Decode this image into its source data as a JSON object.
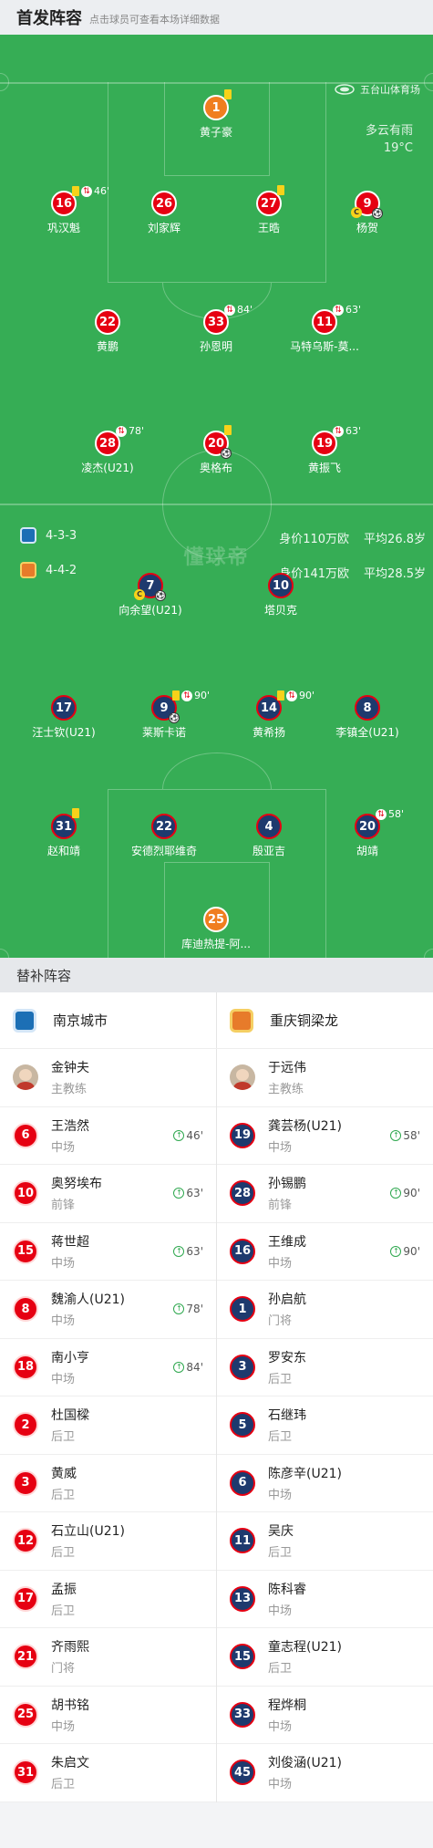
{
  "header": {
    "title": "首发阵容",
    "subtitle": "点击球员可查看本场详细数据"
  },
  "pitch": {
    "venue": "五台山体育场",
    "weather": "多云有雨",
    "temperature": "19°C",
    "watermark": "懂球帝",
    "home_formation": "4-3-3",
    "home_value": "身价110万欧",
    "home_avg_age": "平均26.8岁",
    "away_formation": "4-4-2",
    "away_value": "身价141万欧",
    "away_avg_age": "平均28.5岁",
    "home_players": [
      {
        "num": "1",
        "name": "黄子豪",
        "gk": true,
        "yellow": true
      },
      {
        "num": "16",
        "name": "巩汉魁",
        "yellow": true,
        "sub": "46'"
      },
      {
        "num": "26",
        "name": "刘家辉"
      },
      {
        "num": "27",
        "name": "王晧",
        "yellow": true
      },
      {
        "num": "9",
        "name": "杨贺",
        "captain": "C",
        "ball": true
      },
      {
        "num": "22",
        "name": "黄鹏"
      },
      {
        "num": "33",
        "name": "孙恩明",
        "sub": "84'"
      },
      {
        "num": "11",
        "name": "马特乌斯-莫...",
        "sub": "63'"
      },
      {
        "num": "28",
        "name": "凌杰(U21)",
        "sub": "78'"
      },
      {
        "num": "20",
        "name": "奥格布",
        "yellow": true,
        "ball": true
      },
      {
        "num": "19",
        "name": "黄振飞",
        "sub": "63'"
      }
    ],
    "away_players": [
      {
        "num": "7",
        "name": "向余望(U21)",
        "captain": "C",
        "ball": true
      },
      {
        "num": "10",
        "name": "塔贝克"
      },
      {
        "num": "17",
        "name": "汪士钦(U21)"
      },
      {
        "num": "9",
        "name": "莱斯卡诺",
        "yellow": true,
        "sub": "90'",
        "ball": true
      },
      {
        "num": "14",
        "name": "黄希扬",
        "yellow": true,
        "sub": "90'"
      },
      {
        "num": "8",
        "name": "李镇全(U21)"
      },
      {
        "num": "31",
        "name": "赵和靖",
        "yellow": true
      },
      {
        "num": "22",
        "name": "安德烈耶维奇"
      },
      {
        "num": "4",
        "name": "殷亚吉"
      },
      {
        "num": "20",
        "name": "胡靖",
        "sub": "58'"
      },
      {
        "num": "25",
        "name": "库迪热提-阿...",
        "gk": true
      }
    ]
  },
  "subs": {
    "title": "替补阵容",
    "home_team": "南京城市",
    "away_team": "重庆铜梁龙",
    "home": [
      {
        "coach": true,
        "name": "金钟夫",
        "pos": "主教练"
      },
      {
        "num": "6",
        "name": "王浩然",
        "pos": "中场",
        "min": "46'"
      },
      {
        "num": "10",
        "name": "奥努埃布",
        "pos": "前锋",
        "min": "63'"
      },
      {
        "num": "15",
        "name": "蒋世超",
        "pos": "中场",
        "min": "63'"
      },
      {
        "num": "8",
        "name": "魏渝人(U21)",
        "pos": "中场",
        "min": "78'"
      },
      {
        "num": "18",
        "name": "南小亨",
        "pos": "中场",
        "min": "84'"
      },
      {
        "num": "2",
        "name": "杜国樑",
        "pos": "后卫"
      },
      {
        "num": "3",
        "name": "黄威",
        "pos": "后卫"
      },
      {
        "num": "12",
        "name": "石立山(U21)",
        "pos": "后卫"
      },
      {
        "num": "17",
        "name": "孟振",
        "pos": "后卫"
      },
      {
        "num": "21",
        "name": "齐雨熙",
        "pos": "门将"
      },
      {
        "num": "25",
        "name": "胡书铭",
        "pos": "中场"
      },
      {
        "num": "31",
        "name": "朱启文",
        "pos": "后卫"
      }
    ],
    "away": [
      {
        "coach": true,
        "name": "于远伟",
        "pos": "主教练"
      },
      {
        "num": "19",
        "name": "龚芸杨(U21)",
        "pos": "中场",
        "min": "58'"
      },
      {
        "num": "28",
        "name": "孙锡鹏",
        "pos": "前锋",
        "min": "90'"
      },
      {
        "num": "16",
        "name": "王维成",
        "pos": "中场",
        "min": "90'"
      },
      {
        "num": "1",
        "name": "孙启航",
        "pos": "门将"
      },
      {
        "num": "3",
        "name": "罗安东",
        "pos": "后卫"
      },
      {
        "num": "5",
        "name": "石继玮",
        "pos": "后卫"
      },
      {
        "num": "6",
        "name": "陈彦辛(U21)",
        "pos": "中场"
      },
      {
        "num": "11",
        "name": "吴庆",
        "pos": "后卫"
      },
      {
        "num": "13",
        "name": "陈科睿",
        "pos": "中场"
      },
      {
        "num": "15",
        "name": "童志程(U21)",
        "pos": "后卫"
      },
      {
        "num": "33",
        "name": "程烨桐",
        "pos": "中场"
      },
      {
        "num": "45",
        "name": "刘俊涵(U21)",
        "pos": "中场"
      }
    ]
  }
}
